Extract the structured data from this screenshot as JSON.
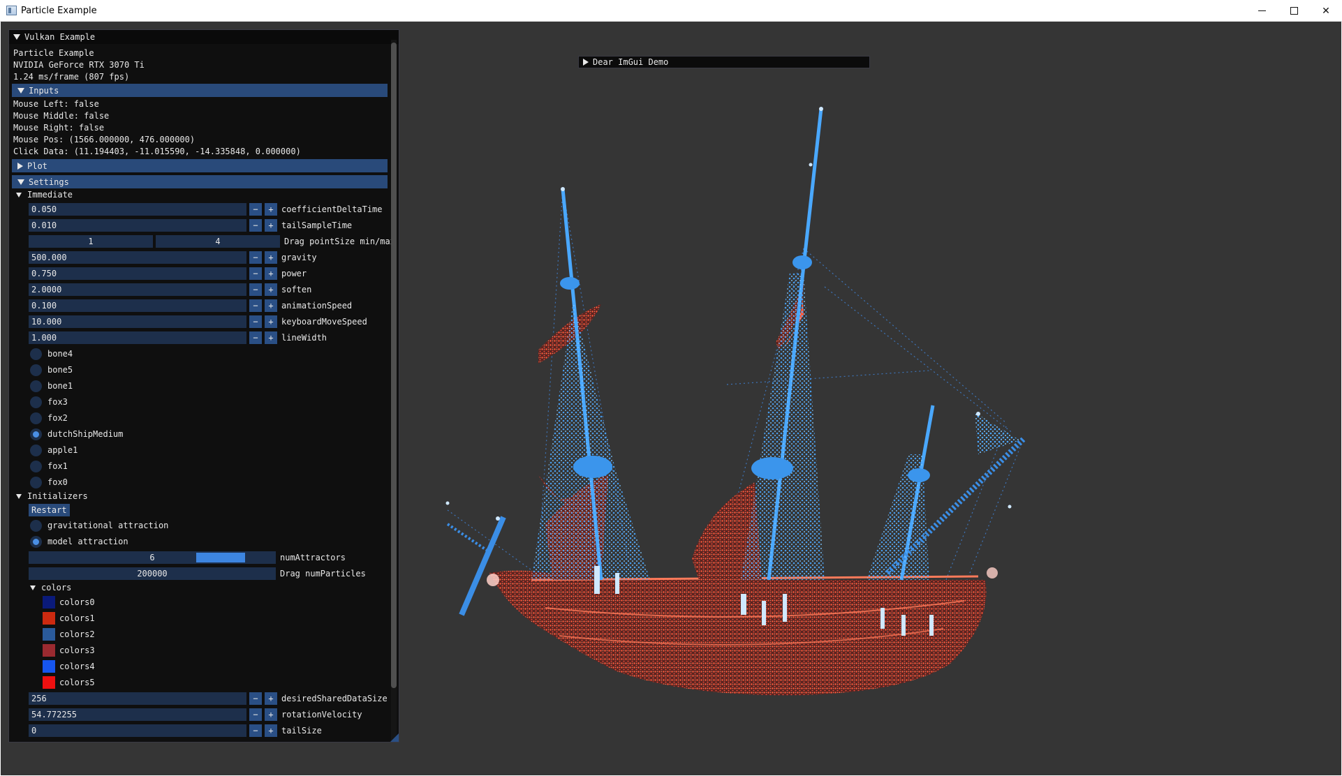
{
  "titlebar": {
    "title": "Particle Example"
  },
  "main_window": {
    "title": "Vulkan Example",
    "app_name": "Particle Example",
    "gpu": "NVIDIA GeForce RTX 3070 Ti",
    "frame_time": "1.24 ms/frame (807 fps)",
    "inputs": {
      "header": "Inputs",
      "mouse_left": "Mouse Left: false",
      "mouse_middle": "Mouse Middle: false",
      "mouse_right": "Mouse Right: false",
      "mouse_pos": "Mouse Pos: (1566.000000, 476.000000)",
      "click_data": "Click Data: (11.194403, -11.015590, -14.335848, 0.000000)"
    },
    "plot_header": "Plot",
    "settings_header": "Settings",
    "immediate": {
      "label": "Immediate",
      "fields": [
        {
          "value": "0.050",
          "label": "coefficientDeltaTime"
        },
        {
          "value": "0.010",
          "label": "tailSampleTime"
        }
      ],
      "point_size": {
        "min": "1",
        "max": "4",
        "label": "Drag pointSize min/max"
      },
      "fields2": [
        {
          "value": "500.000",
          "label": "gravity"
        },
        {
          "value": "0.750",
          "label": "power"
        },
        {
          "value": "2.0000",
          "label": "soften"
        },
        {
          "value": "0.100",
          "label": "animationSpeed"
        },
        {
          "value": "10.000",
          "label": "keyboardMoveSpeed"
        },
        {
          "value": "1.000",
          "label": "lineWidth"
        }
      ],
      "models": [
        {
          "label": "bone4",
          "selected": false
        },
        {
          "label": "bone5",
          "selected": false
        },
        {
          "label": "bone1",
          "selected": false
        },
        {
          "label": "fox3",
          "selected": false
        },
        {
          "label": "fox2",
          "selected": false
        },
        {
          "label": "dutchShipMedium",
          "selected": true
        },
        {
          "label": "apple1",
          "selected": false
        },
        {
          "label": "fox1",
          "selected": false
        },
        {
          "label": "fox0",
          "selected": false
        }
      ]
    },
    "initializers": {
      "label": "Initializers",
      "restart_label": "Restart",
      "modes": [
        {
          "label": "gravitational attraction",
          "selected": false
        },
        {
          "label": "model attraction",
          "selected": true
        }
      ],
      "num_attractors": {
        "value": "6",
        "label": "numAttractors",
        "fraction": 0.85
      },
      "num_particles": {
        "value": "200000",
        "label": "Drag numParticles"
      },
      "colors_label": "colors",
      "colors": [
        {
          "label": "colors0",
          "color": "#0a1a7a"
        },
        {
          "label": "colors1",
          "color": "#cc2a10"
        },
        {
          "label": "colors2",
          "color": "#2a5a9a"
        },
        {
          "label": "colors3",
          "color": "#9a2a30"
        },
        {
          "label": "colors4",
          "color": "#1655ee"
        },
        {
          "label": "colors5",
          "color": "#ee1010"
        }
      ],
      "fields": [
        {
          "value": "256",
          "label": "desiredSharedDataSize"
        },
        {
          "value": "54.772255",
          "label": "rotationVelocity"
        },
        {
          "value": "0",
          "label": "tailSize"
        }
      ]
    },
    "stepper": {
      "minus": "−",
      "plus": "+"
    }
  },
  "demo_window": {
    "title": "Dear ImGui Demo"
  },
  "accent_colors": {
    "header": "#294a7a",
    "frame": "#1d2f4b",
    "check": "#4a8fe6",
    "viewport": "#353535"
  }
}
